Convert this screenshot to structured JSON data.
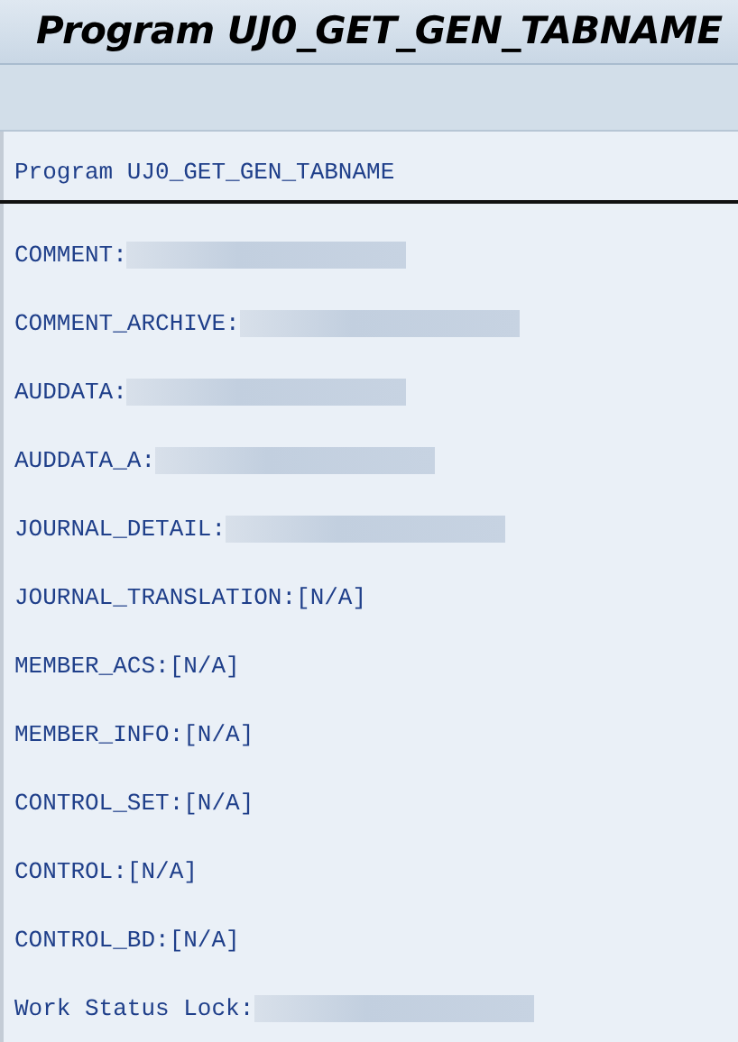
{
  "window": {
    "title": "Program UJ0_GET_GEN_TABNAME"
  },
  "list_heading": "Program UJ0_GET_GEN_TABNAME",
  "lines": [
    {
      "kind": "redacted",
      "label": "COMMENT:"
    },
    {
      "kind": "redacted",
      "label": "COMMENT_ARCHIVE:"
    },
    {
      "kind": "redacted",
      "label": "AUDDATA:"
    },
    {
      "kind": "redacted",
      "label": "AUDDATA_A:"
    },
    {
      "kind": "redacted",
      "label": "JOURNAL_DETAIL:"
    },
    {
      "kind": "text",
      "label": "JOURNAL_TRANSLATION:",
      "value": "[N/A]"
    },
    {
      "kind": "text",
      "label": "MEMBER_ACS:",
      "value": "[N/A]"
    },
    {
      "kind": "text",
      "label": "MEMBER_INFO:",
      "value": "[N/A]"
    },
    {
      "kind": "text",
      "label": "CONTROL_SET:",
      "value": "[N/A]"
    },
    {
      "kind": "text",
      "label": "CONTROL:",
      "value": "[N/A]"
    },
    {
      "kind": "text",
      "label": "CONTROL_BD:",
      "value": "[N/A]"
    },
    {
      "kind": "redacted",
      "label": "Work Status Lock:"
    }
  ]
}
